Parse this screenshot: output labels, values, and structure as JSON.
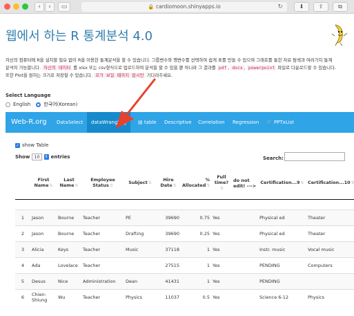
{
  "browser": {
    "url": "cardiomoon.shinyapps.io"
  },
  "page": {
    "title": "웹에서 하는 R 통계분석 4.0",
    "description": {
      "p1": "자신의 컴퓨터에 R을 설치할 필요 없이 R을 이용한 통계분석을 할 수 있습니다. 그룹변수와 행변수를 선택하여 쉽게 표를 만들 수 있으며 그래프를 통한 자료 탐색과 여러가지 통계",
      "p2": "분석이 가능합니다. ",
      "code1": "자신의 데이터",
      "p3": " 를 xlsx 또는 csv형식으로 업로드하여 분석을 할 수 있을 뿐 아니라 그 결과를 ",
      "code2": "pdf",
      "sep1": ", ",
      "code3": "docx",
      "sep2": ", ",
      "code4": "powerpoint",
      "p4": " 파일로 다운로드할 수 있습니다.",
      "p5": "또한 Plot을 원하는 크기로 저장할 수 있습니다. ",
      "code5": "로가 보일 때까지 잠시만",
      "p6": " 기다려주세요."
    }
  },
  "language": {
    "label": "Select Language",
    "options": [
      "English",
      "한국어(Korean)"
    ],
    "selected": "한국어(Korean)"
  },
  "navbar": {
    "brand": "Web-R.org",
    "items": [
      "DataSelect",
      "dataWrangling",
      "table",
      "Descriptive",
      "Correlation",
      "Regression",
      "PPTxList"
    ],
    "active": "dataWrangling"
  },
  "table_controls": {
    "show_table": "show Table",
    "show": "Show",
    "page_size": "10",
    "entries": "entries",
    "search_label": "Search:",
    "search_value": ""
  },
  "table": {
    "columns": [
      "",
      "First Name",
      "Last Name",
      "Employee Status",
      "Subject",
      "Hire Date",
      "% Allocated",
      "Full time?",
      "do not edit! --->",
      "Certification...9",
      "Certification...10"
    ],
    "rows": [
      [
        "1",
        "Jason",
        "Bourne",
        "Teacher",
        "PE",
        "39690",
        "0.75",
        "Yes",
        "",
        "Physical ed",
        "Theater"
      ],
      [
        "2",
        "Jason",
        "Bourne",
        "Teacher",
        "Drafting",
        "39690",
        "0.25",
        "Yes",
        "",
        "Physical ed",
        "Theater"
      ],
      [
        "3",
        "Alicia",
        "Keys",
        "Teacher",
        "Music",
        "37118",
        "1",
        "Yes",
        "",
        "Instr. music",
        "Vocal music"
      ],
      [
        "4",
        "Ada",
        "Lovelace",
        "Teacher",
        "",
        "27515",
        "1",
        "Yes",
        "",
        "PENDING",
        "Computers"
      ],
      [
        "5",
        "Desus",
        "Nice",
        "Administration",
        "Dean",
        "41431",
        "1",
        "Yes",
        "",
        "PENDING",
        ""
      ],
      [
        "6",
        "Chien-Shiung",
        "Wu",
        "Teacher",
        "Physics",
        "11037",
        "0.5",
        "Yes",
        "",
        "Science 6-12",
        "Physics"
      ]
    ]
  },
  "colors": {
    "navbar": "#2fa4e7",
    "navbar_active": "#178acc",
    "title": "#317eac",
    "arrow": "#e8412c"
  }
}
